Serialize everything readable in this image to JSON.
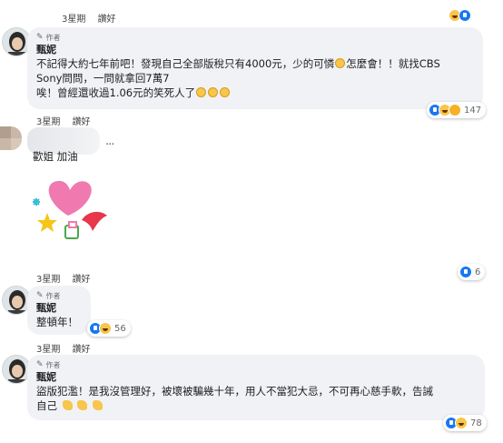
{
  "top_meta": {
    "time": "3星期",
    "reply": "讚好"
  },
  "comment1": {
    "author_badge": "作者",
    "name": "甄妮",
    "line1_a": "不記得大約七年前吧！發現自己全部版稅只有4000元，少的可憐",
    "line1_b": "怎麼會！！就找CBS",
    "line2": "Sony問問，一問就拿回7萬7",
    "line3": "唉！曾經還收過1.06元的笑死人了",
    "time": "3星期",
    "like": "讚好",
    "reaction_count": "147"
  },
  "comment2": {
    "text": "歡姐 加油",
    "more": "···",
    "time": "3星期",
    "like": "讚好",
    "reaction_count": "6"
  },
  "comment3": {
    "author_badge": "作者",
    "name": "甄妮",
    "text": "整頓年！",
    "reaction_count": "56",
    "time": "3星期",
    "like": "讚好"
  },
  "comment4": {
    "author_badge": "作者",
    "name": "甄妮",
    "line1": "盜版犯濫！是我沒管理好，被壞被騙幾十年，用人不當犯大忌，不可再心慈手軟，告誡",
    "line2": "自己",
    "reaction_count": "78"
  },
  "icons": {
    "pen": "pen-icon",
    "like": "like-reaction-icon",
    "haha": "haha-reaction-icon",
    "care": "care-reaction-icon",
    "more": "more-options-icon"
  },
  "colors": {
    "like_blue": "#1877f2",
    "bubble": "#f0f2f5",
    "text": "#1c1e21"
  }
}
